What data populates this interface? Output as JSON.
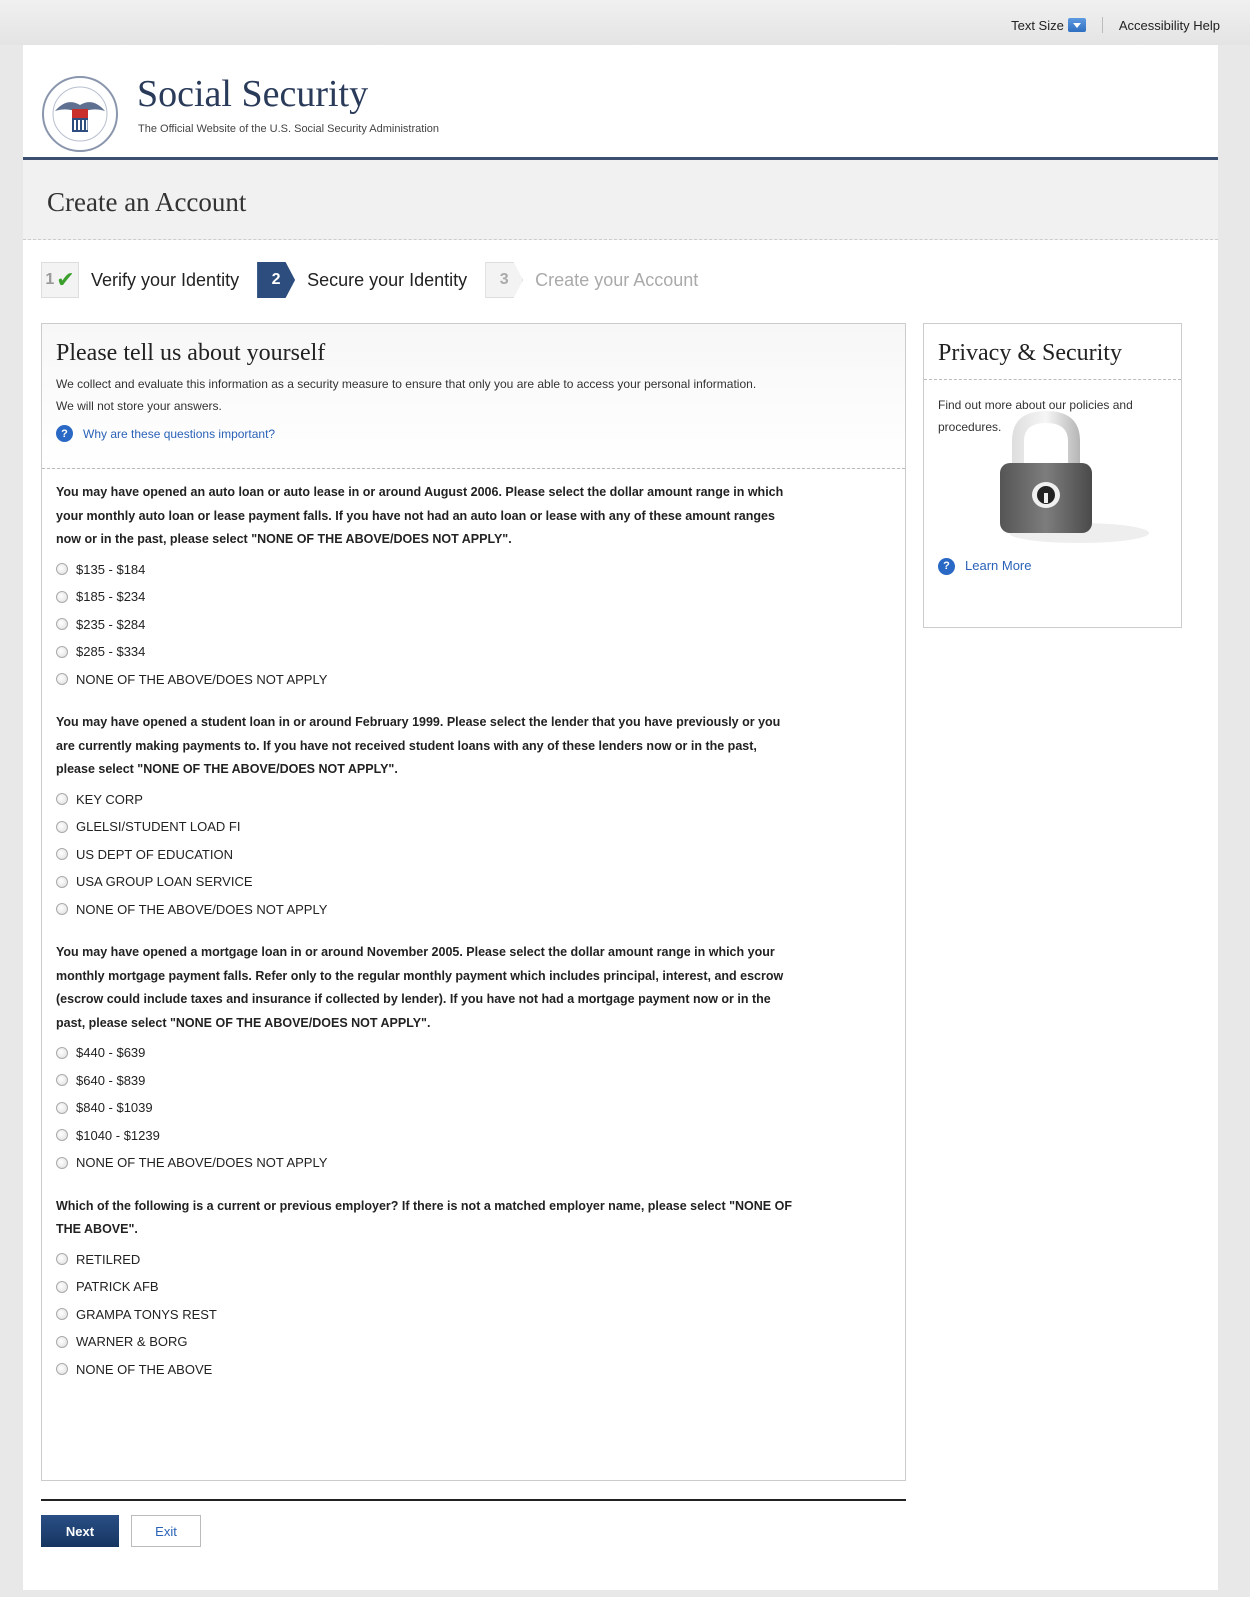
{
  "utility": {
    "text_size_label": "Text Size",
    "accessibility_label": "Accessibility Help"
  },
  "header": {
    "title": "Social Security",
    "subtitle": "The Official Website of the U.S. Social Security Administration"
  },
  "page_title": "Create an Account",
  "steps": [
    {
      "num": "1",
      "label": "Verify your Identity"
    },
    {
      "num": "2",
      "label": "Secure your Identity"
    },
    {
      "num": "3",
      "label": "Create your Account"
    }
  ],
  "main": {
    "heading": "Please tell us about yourself",
    "intro_1": "We collect and evaluate this information as a security measure to ensure that only you are able to access your personal information.",
    "intro_2": "We will not store your answers.",
    "help_link": "Why are these questions important?",
    "questions": [
      {
        "text": "You may have opened an auto loan or auto lease in or around August 2006. Please select the dollar amount range in which your monthly auto loan or lease payment falls. If you have not had an auto loan or lease with any of these amount ranges now or in the past, please select \"NONE OF THE ABOVE/DOES NOT APPLY\".",
        "options": [
          "$135 - $184",
          "$185 - $234",
          "$235 - $284",
          "$285 - $334",
          "NONE OF THE ABOVE/DOES NOT APPLY"
        ]
      },
      {
        "text": "You may have opened a student loan in or around February 1999. Please select the lender that you have previously or you are currently making payments to. If you have not received student loans with any of these lenders now or in the past, please select \"NONE OF THE ABOVE/DOES NOT APPLY\".",
        "options": [
          "KEY CORP",
          "GLELSI/STUDENT LOAD FI",
          "US DEPT OF EDUCATION",
          "USA GROUP LOAN SERVICE",
          "NONE OF THE ABOVE/DOES NOT APPLY"
        ]
      },
      {
        "text": "You may have opened a mortgage loan in or around November 2005. Please select the dollar amount range in which your monthly mortgage payment falls. Refer only to the regular monthly payment which includes principal, interest, and escrow (escrow could include taxes and insurance if collected by lender). If you have not had a mortgage payment now or in the past, please select \"NONE OF THE ABOVE/DOES NOT APPLY\".",
        "options": [
          "$440 - $639",
          "$640 - $839",
          "$840 - $1039",
          "$1040 - $1239",
          "NONE OF THE ABOVE/DOES NOT APPLY"
        ]
      },
      {
        "text": "Which of the following is a current or previous employer? If there is not a matched employer name, please select \"NONE OF THE ABOVE\".",
        "options": [
          "RETILRED",
          "PATRICK AFB",
          "GRAMPA TONYS REST",
          "WARNER & BORG",
          "NONE OF THE ABOVE"
        ]
      }
    ]
  },
  "side": {
    "heading": "Privacy & Security",
    "text": "Find out more about our policies and procedures.",
    "link": "Learn More"
  },
  "buttons": {
    "next": "Next",
    "exit": "Exit"
  },
  "icons": {
    "help": "question-circle-icon",
    "check": "checkmark-icon",
    "lock": "padlock-icon",
    "dropdown": "dropdown-arrow-icon"
  },
  "colors": {
    "brand_navy": "#2c4d7d",
    "link_blue": "#2a62b8",
    "check_green": "#3aa02b"
  }
}
